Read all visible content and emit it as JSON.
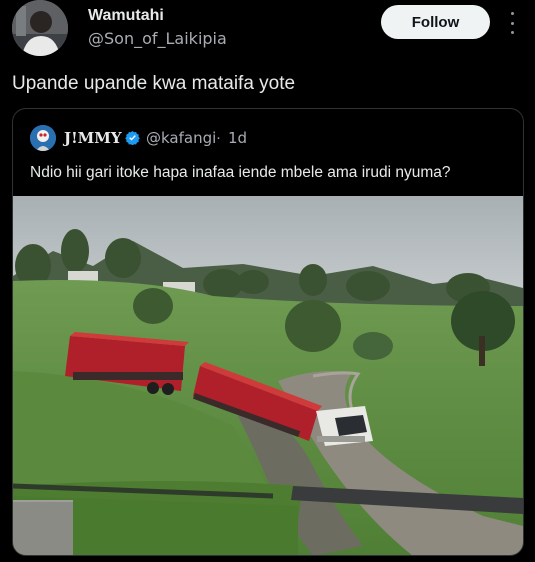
{
  "tweet": {
    "author_name": "Wamutahi",
    "author_handle": "@Son_of_Laikipia",
    "follow_label": "Follow",
    "text": "Upande upande kwa mataifa yote"
  },
  "quote": {
    "author_name": "J!MMY",
    "author_handle": "@kafangi",
    "separator": "·",
    "time": "1d",
    "text": "Ndio hii gari itoke hapa inafaa iende mbele ama irudi nyuma?"
  },
  "colors": {
    "background": "#000000",
    "follow_button": "#eff3f4",
    "verified_badge": "#1d9bf0",
    "truck_red": "#b0202a"
  },
  "icons": [
    "more-options-icon",
    "verified-badge-icon"
  ]
}
